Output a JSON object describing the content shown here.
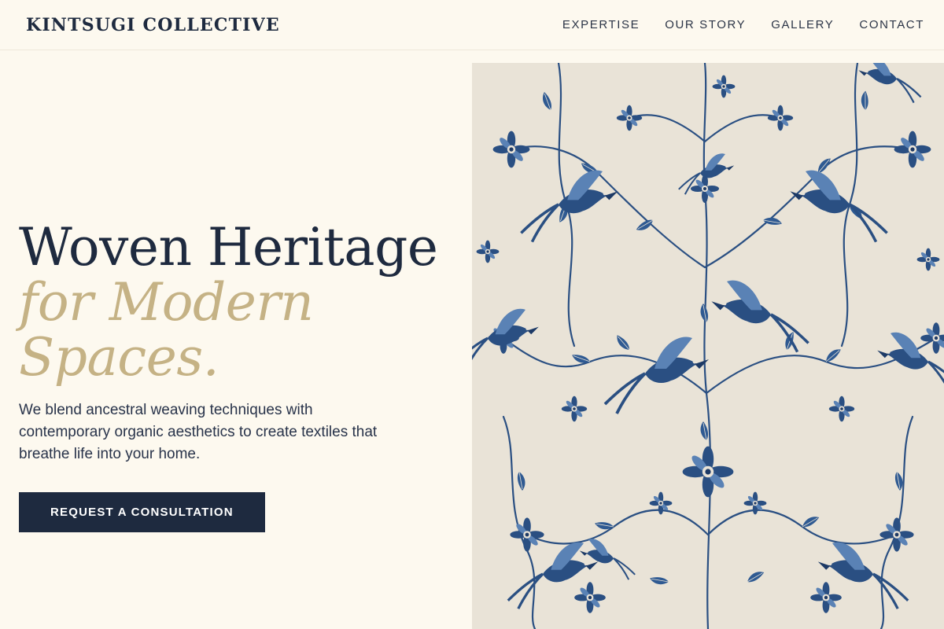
{
  "brand": {
    "name": "KINTSUGI COLLECTIVE"
  },
  "nav": {
    "items": [
      "EXPERTISE",
      "OUR STORY",
      "GALLERY",
      "CONTACT"
    ]
  },
  "hero": {
    "line1": "Woven Heritage",
    "line2": "for Modern",
    "line3": "Spaces.",
    "description": "We blend ancestral weaving techniques with contemporary organic aesthetics to create textiles that breathe life into your home.",
    "cta": "REQUEST A CONSULTATION",
    "image_icon": "floral-textile-pattern"
  },
  "colors": {
    "navy": "#1e2a3f",
    "gold": "#c5b285",
    "cream": "#fdf9ef",
    "indigo": "#2a4f82"
  }
}
